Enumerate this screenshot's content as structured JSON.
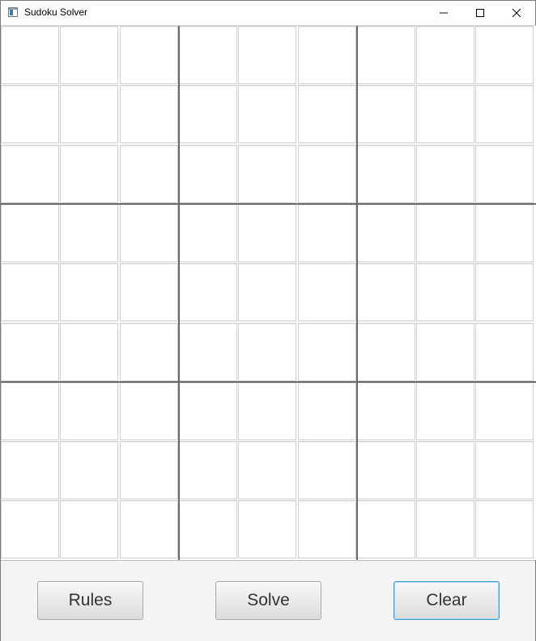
{
  "window": {
    "title": "Sudoku Solver",
    "icon": "app-icon",
    "controls": [
      "minimize-icon",
      "maximize-icon",
      "close-icon"
    ]
  },
  "grid": {
    "rows": 9,
    "cols": 9,
    "values": [
      [
        "",
        "",
        "",
        "",
        "",
        "",
        "",
        "",
        ""
      ],
      [
        "",
        "",
        "",
        "",
        "",
        "",
        "",
        "",
        ""
      ],
      [
        "",
        "",
        "",
        "",
        "",
        "",
        "",
        "",
        ""
      ],
      [
        "",
        "",
        "",
        "",
        "",
        "",
        "",
        "",
        ""
      ],
      [
        "",
        "",
        "",
        "",
        "",
        "",
        "",
        "",
        ""
      ],
      [
        "",
        "",
        "",
        "",
        "",
        "",
        "",
        "",
        ""
      ],
      [
        "",
        "",
        "",
        "",
        "",
        "",
        "",
        "",
        ""
      ],
      [
        "",
        "",
        "",
        "",
        "",
        "",
        "",
        "",
        ""
      ],
      [
        "",
        "",
        "",
        "",
        "",
        "",
        "",
        "",
        ""
      ]
    ]
  },
  "buttons": {
    "rules": "Rules",
    "solve": "Solve",
    "clear": "Clear"
  },
  "colors": {
    "focused_button_border": "#3c9fd8",
    "box_separator": "#6a6a6a",
    "cell_border": "#cfcfcf"
  }
}
